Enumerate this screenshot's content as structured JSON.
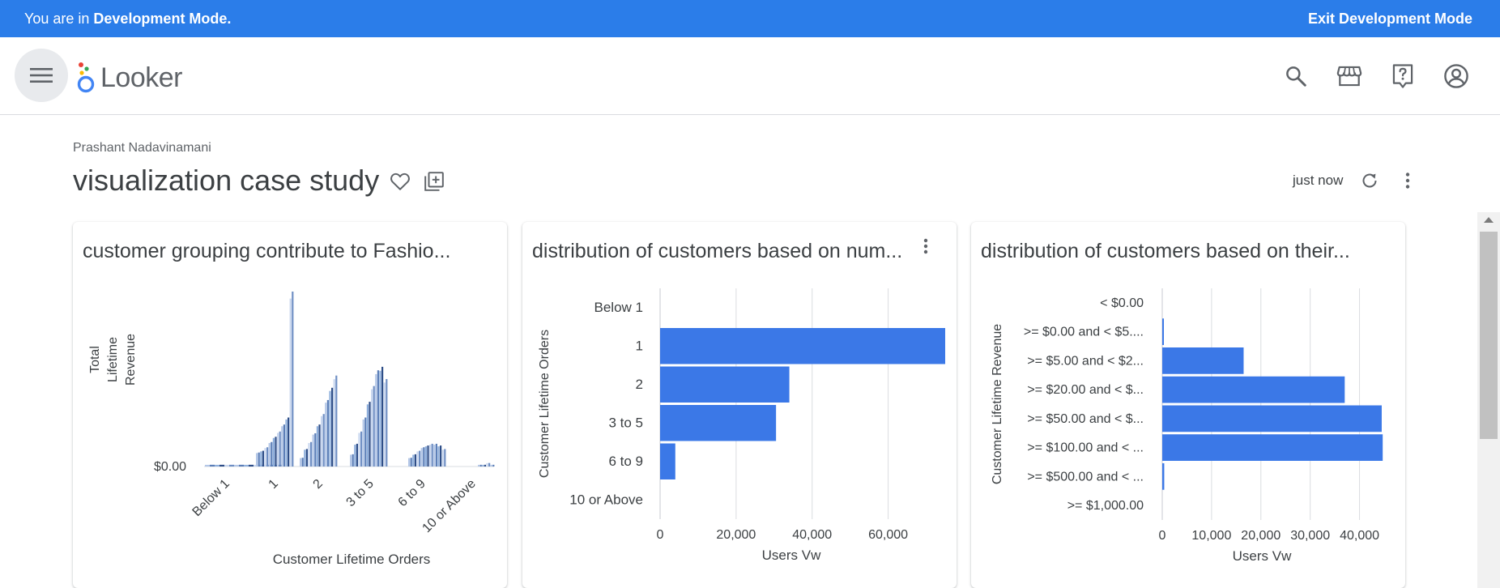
{
  "devbar": {
    "prefix": "You are in ",
    "mode": "Development Mode.",
    "exit_label": "Exit Development Mode"
  },
  "nav": {
    "logo_text": "Looker",
    "icons": [
      "search-icon",
      "marketplace-icon",
      "help-icon",
      "account-icon"
    ]
  },
  "dashboard": {
    "owner": "Prashant Nadavinamani",
    "title": "visualization case study",
    "refreshed": "just now"
  },
  "colors": {
    "dev_bar": "#2b7de9",
    "bar_blue": "#3b78e7",
    "grid": "#dadce0"
  },
  "tiles": [
    {
      "title": "customer grouping contribute to Fashio...",
      "chart_data": {
        "type": "bar",
        "ylabel": "Total Lifetime Revenue",
        "y_tick": "$0.00",
        "xlabel": "Customer Lifetime Orders",
        "categories": [
          "Below 1",
          "1",
          "2",
          "3 to 5",
          "6 to 9",
          "10 or Above"
        ],
        "series_relative_heights": [
          [
            0.01,
            0.01,
            0.01,
            0.01,
            0.01,
            0.01,
            0.01,
            0.01
          ],
          [
            0.08,
            0.09,
            0.11,
            0.14,
            0.17,
            0.2,
            0.24,
            0.28,
            1.0
          ],
          [
            0.05,
            0.1,
            0.14,
            0.19,
            0.24,
            0.3,
            0.38,
            0.45,
            0.52
          ],
          [
            0.07,
            0.13,
            0.2,
            0.28,
            0.37,
            0.46,
            0.55,
            0.57,
            0.5
          ],
          [
            0.05,
            0.07,
            0.09,
            0.11,
            0.12,
            0.13,
            0.13,
            0.12,
            0.1
          ],
          [
            0.01,
            0.01,
            0.02,
            0.01
          ]
        ]
      }
    },
    {
      "title": "distribution of customers based on num...",
      "chart_data": {
        "type": "bar",
        "orientation": "horizontal",
        "ylabel": "Customer Lifetime Orders",
        "xlabel": "Users Vw",
        "categories": [
          "Below 1",
          "1",
          "2",
          "3 to 5",
          "6 to 9",
          "10 or Above"
        ],
        "values": [
          0,
          75000,
          34000,
          30500,
          4000,
          0
        ],
        "xlim": [
          0,
          75000
        ],
        "xticks": [
          0,
          20000,
          40000,
          60000
        ],
        "xtick_labels": [
          "0",
          "20,000",
          "40,000",
          "60,000"
        ]
      }
    },
    {
      "title": "distribution of customers based on their...",
      "chart_data": {
        "type": "bar",
        "orientation": "horizontal",
        "ylabel": "Customer Lifetime Revenue",
        "xlabel": "Users Vw",
        "categories": [
          "< $0.00",
          ">= $0.00 and < $5....",
          ">= $5.00 and < $2...",
          ">= $20.00 and < $...",
          ">= $50.00 and < $...",
          ">= $100.00 and < ...",
          ">= $500.00 and < ...",
          ">= $1,000.00"
        ],
        "values": [
          0,
          300,
          16500,
          37000,
          44500,
          44700,
          400,
          0
        ],
        "xlim": [
          0,
          45000
        ],
        "xticks": [
          0,
          10000,
          20000,
          30000,
          40000
        ],
        "xtick_labels": [
          "0",
          "10,000",
          "20,000",
          "30,000",
          "40,000"
        ]
      }
    }
  ]
}
